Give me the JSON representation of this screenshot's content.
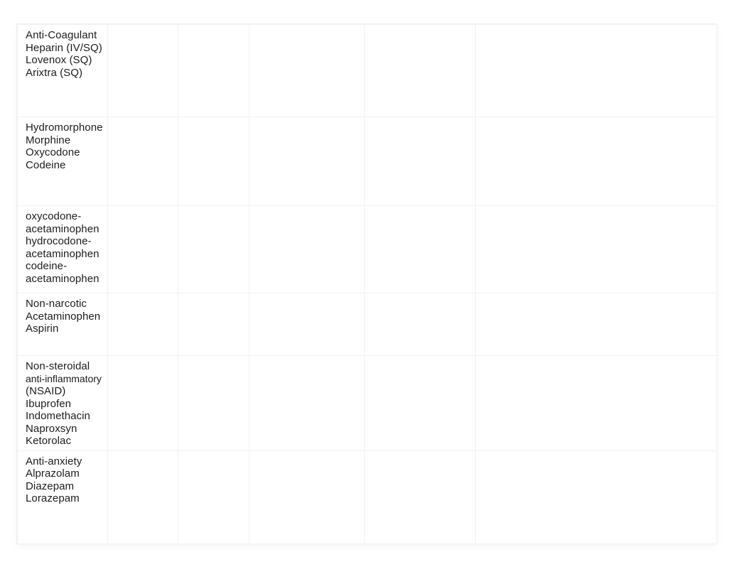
{
  "document": {
    "table": {
      "column_count": 6,
      "row_count": 6,
      "gridline_color": "#f1f1f1",
      "text_color": "#1c1c1c",
      "background_color": "#ffffff",
      "rows": [
        {
          "id": "anticoagulant",
          "cells": [
            {
              "lines": [
                "Anti-Coagulant",
                "Heparin (IV/SQ)",
                "Lovenox (SQ)",
                "Arixtra (SQ)"
              ]
            },
            {
              "lines": []
            },
            {
              "lines": []
            },
            {
              "lines": []
            },
            {
              "lines": []
            },
            {
              "lines": []
            }
          ]
        },
        {
          "id": "opioids",
          "cells": [
            {
              "lines": [
                "Hydromorphone",
                "Morphine",
                "Oxycodone",
                "Codeine"
              ]
            },
            {
              "lines": []
            },
            {
              "lines": []
            },
            {
              "lines": []
            },
            {
              "lines": []
            },
            {
              "lines": []
            }
          ]
        },
        {
          "id": "combination-opioids",
          "cells": [
            {
              "lines": [
                "oxycodone-",
                "acetaminophen",
                "hydrocodone-",
                "acetaminophen",
                "codeine-",
                "acetaminophen"
              ]
            },
            {
              "lines": []
            },
            {
              "lines": []
            },
            {
              "lines": []
            },
            {
              "lines": []
            },
            {
              "lines": []
            }
          ]
        },
        {
          "id": "non-narcotic",
          "cells": [
            {
              "lines": [
                "Non-narcotic",
                "Acetaminophen",
                "Aspirin"
              ]
            },
            {
              "lines": []
            },
            {
              "lines": []
            },
            {
              "lines": []
            },
            {
              "lines": []
            },
            {
              "lines": []
            }
          ]
        },
        {
          "id": "nsaid",
          "cells": [
            {
              "lines": [
                "Non-steroidal",
                "anti-inflammatory",
                "(NSAID)",
                "Ibuprofen",
                "Indomethacin",
                "Naproxsyn",
                "Ketorolac"
              ],
              "condensed_line_indexes": [
                1
              ]
            },
            {
              "lines": []
            },
            {
              "lines": []
            },
            {
              "lines": []
            },
            {
              "lines": []
            },
            {
              "lines": []
            }
          ]
        },
        {
          "id": "anti-anxiety",
          "cells": [
            {
              "lines": [
                "Anti-anxiety",
                "Alprazolam",
                "Diazepam",
                "Lorazepam"
              ]
            },
            {
              "lines": []
            },
            {
              "lines": []
            },
            {
              "lines": []
            },
            {
              "lines": []
            },
            {
              "lines": []
            }
          ]
        }
      ]
    }
  }
}
